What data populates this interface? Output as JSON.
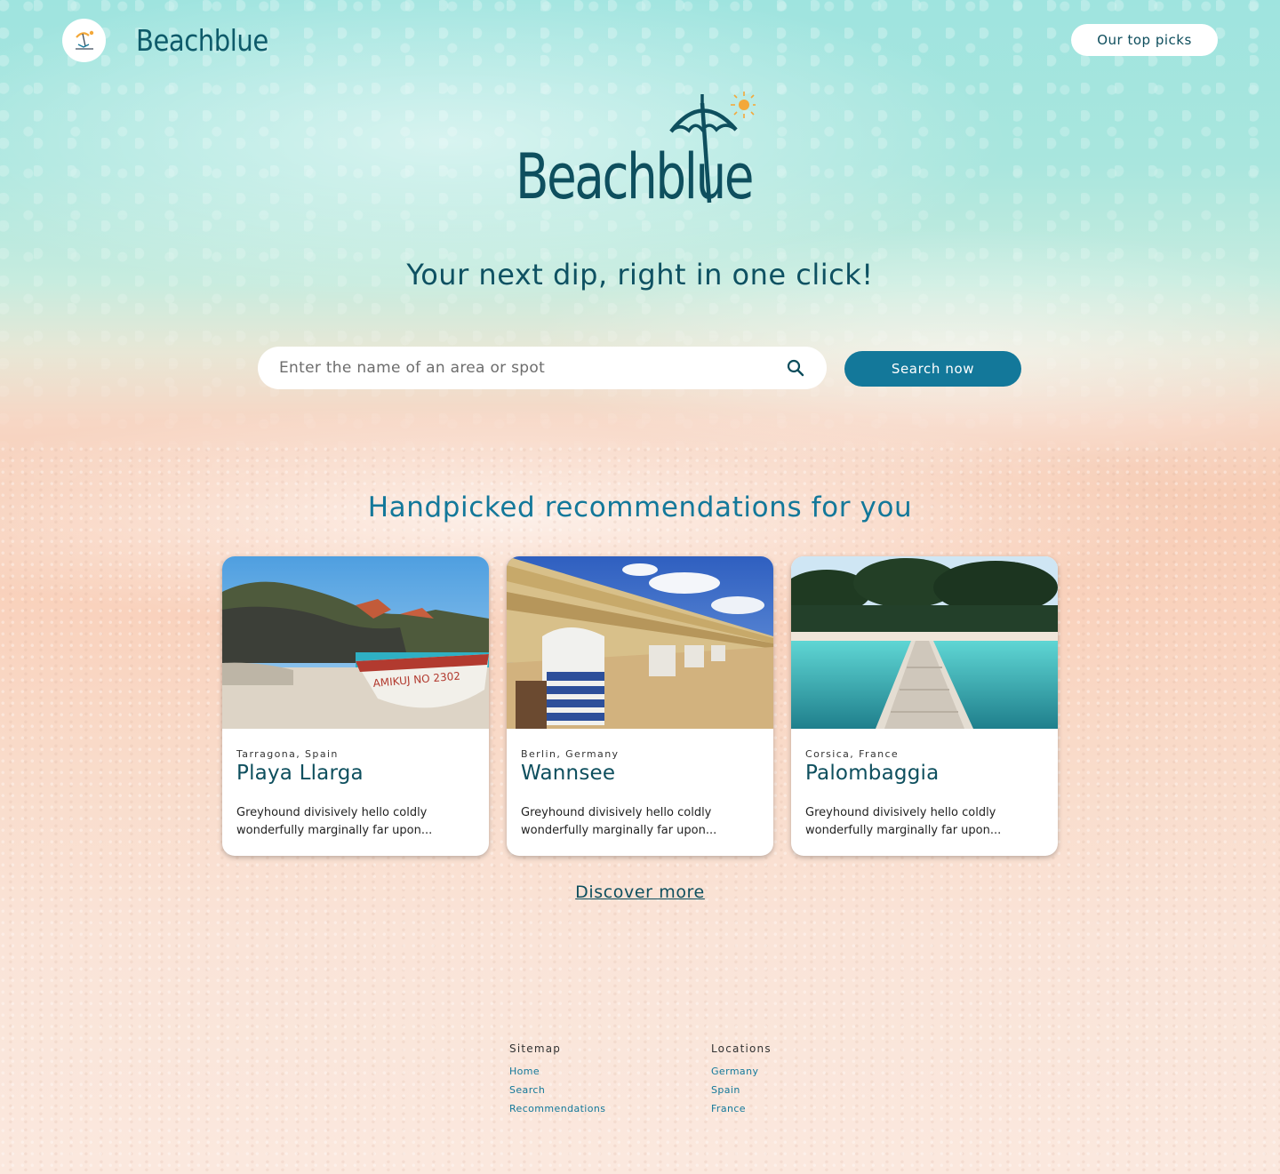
{
  "header": {
    "brand": "Beachblue",
    "top_picks_label": "Our top picks"
  },
  "hero": {
    "brand": "Beachblue",
    "tagline": "Your next dip, right in one click!"
  },
  "search": {
    "placeholder": "Enter the name of an area or spot",
    "value": "",
    "button_label": "Search now"
  },
  "recommendations": {
    "title": "Handpicked recommendations for you",
    "cards": [
      {
        "location": "Tarragona, Spain",
        "name": "Playa Llarga",
        "description": "Greyhound divisively hello coldly wonderfully marginally far upon...",
        "boat_text": "AMIKUJ NO 2302"
      },
      {
        "location": "Berlin, Germany",
        "name": "Wannsee",
        "description": "Greyhound divisively hello coldly wonderfully marginally far upon..."
      },
      {
        "location": "Corsica, France",
        "name": "Palombaggia",
        "description": "Greyhound divisively hello coldly wonderfully marginally far upon..."
      }
    ],
    "discover_label": "Discover more"
  },
  "footer": {
    "sitemap": {
      "heading": "Sitemap",
      "links": [
        "Home",
        "Search",
        "Recommendations"
      ]
    },
    "locations": {
      "heading": "Locations",
      "links": [
        "Germany",
        "Spain",
        "France"
      ]
    }
  },
  "colors": {
    "primary": "#13789a",
    "brand_text": "#0e4f5e",
    "sun": "#f3a83a"
  }
}
